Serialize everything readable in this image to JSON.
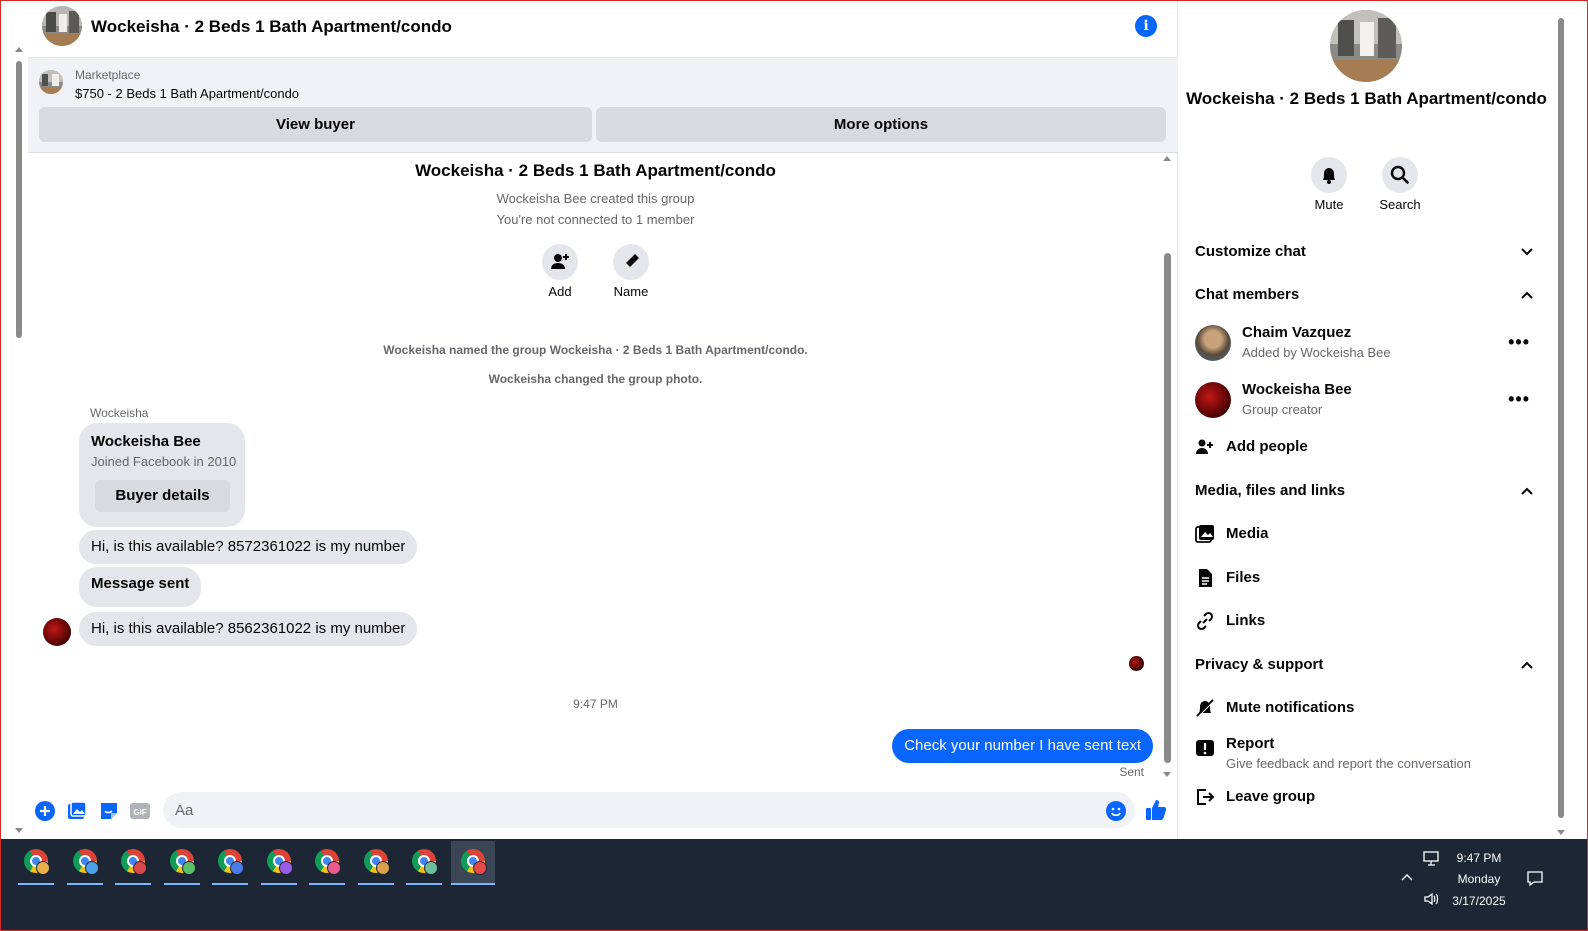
{
  "chat": {
    "title": "Wockeisha · 2 Beds 1 Bath Apartment/condo",
    "marketplace": {
      "label": "Marketplace",
      "listing": "$750 - 2 Beds 1 Bath Apartment/condo",
      "view_buyer": "View buyer",
      "more_options": "More options"
    },
    "group": {
      "title": "Wockeisha · 2 Beds 1 Bath Apartment/condo",
      "created": "Wockeisha Bee created this group",
      "connected": "You're not connected to 1 member",
      "add_label": "Add",
      "name_label": "Name"
    },
    "system": [
      "Wockeisha named the group Wockeisha · 2 Beds 1 Bath Apartment/condo.",
      "Wockeisha changed the group photo."
    ],
    "sender": "Wockeisha",
    "card": {
      "name": "Wockeisha Bee",
      "joined": "Joined Facebook in 2010",
      "button": "Buyer details"
    },
    "messages": [
      "Hi, is this available? 8572361022 is my number",
      "Message sent",
      "Hi, is this available? 8562361022 is my number"
    ],
    "timestamp": "9:47 PM",
    "outgoing": "Check your number I have sent text",
    "status": "Sent",
    "composer": {
      "placeholder": "Aa",
      "icons": [
        "plus-icon",
        "photo-icon",
        "sticker-icon",
        "gif-icon",
        "emoji-icon",
        "thumbs-up-icon"
      ],
      "gif_label": "GIF"
    }
  },
  "panel": {
    "name": "Wockeisha · 2 Beds 1 Bath Apartment/condo",
    "mute": "Mute",
    "search": "Search",
    "sections": {
      "customize": "Customize chat",
      "members": "Chat members",
      "media": "Media, files and links",
      "privacy": "Privacy & support"
    },
    "members": [
      {
        "name": "Chaim Vazquez",
        "sub": "Added by Wockeisha Bee"
      },
      {
        "name": "Wockeisha Bee",
        "sub": "Group creator"
      }
    ],
    "add_people": "Add people",
    "media_items": [
      "Media",
      "Files",
      "Links"
    ],
    "mute_notifications": "Mute notifications",
    "report": "Report",
    "report_sub": "Give feedback and report the conversation",
    "leave": "Leave group",
    "more_label": "•••"
  },
  "taskbar": {
    "time": "9:47 PM",
    "day": "Monday",
    "date": "3/17/2025",
    "apps": [
      "chrome-icon",
      "chrome-icon",
      "chrome-icon",
      "chrome-icon",
      "chrome-icon",
      "chrome-icon",
      "chrome-icon",
      "chrome-icon",
      "chrome-icon",
      "chrome-icon"
    ],
    "profile_colors": [
      "#e8b04a",
      "#4aa3e8",
      "#d84a4a",
      "#5bbf6a",
      "#4a7de8",
      "#9a5be8",
      "#e85b8a",
      "#d8a14a",
      "#6abf9a",
      "#e84a4a"
    ]
  },
  "colors": {
    "accent": "#0866ff",
    "bubble_gray": "#e4e6eb",
    "taskbar": "#1c2635"
  }
}
